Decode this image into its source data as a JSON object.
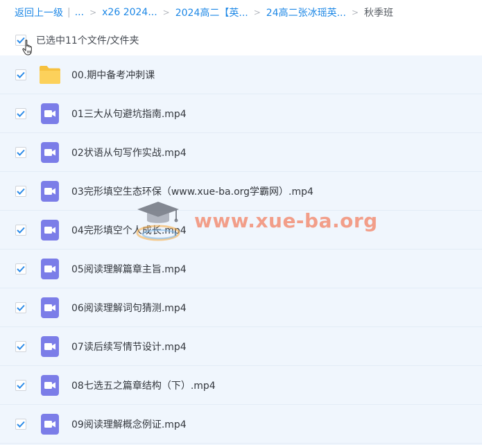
{
  "breadcrumb": {
    "back_label": "返回上一级",
    "pipe": "|",
    "ellipsis": "...",
    "items": [
      "x26 2024...",
      "2024高二【英...",
      "24高二张冰瑶英..."
    ],
    "current": "秋季班"
  },
  "selection": {
    "checked": true,
    "label": "已选中11个文件/文件夹"
  },
  "files": [
    {
      "name": "00.期中备考冲刺课",
      "type": "folder",
      "checked": true
    },
    {
      "name": "01三大从句避坑指南.mp4",
      "type": "video",
      "checked": true
    },
    {
      "name": "02状语从句写作实战.mp4",
      "type": "video",
      "checked": true
    },
    {
      "name": "03完形填空生态环保（www.xue-ba.org学霸网）.mp4",
      "type": "video",
      "checked": true
    },
    {
      "name": "04完形填空个人成长.mp4",
      "type": "video",
      "checked": true
    },
    {
      "name": "05阅读理解篇章主旨.mp4",
      "type": "video",
      "checked": true
    },
    {
      "name": "06阅读理解词句猜测.mp4",
      "type": "video",
      "checked": true
    },
    {
      "name": "07读后续写情节设计.mp4",
      "type": "video",
      "checked": true
    },
    {
      "name": "08七选五之篇章结构（下）.mp4",
      "type": "video",
      "checked": true
    },
    {
      "name": "09阅读理解概念例证.mp4",
      "type": "video",
      "checked": true
    }
  ],
  "icons": {
    "checkbox": "checkbox-checked-icon",
    "folder": "folder-icon",
    "video": "video-file-icon",
    "cursor": "hand-pointer-icon",
    "breadcrumb_separator": "chevron-right-icon"
  },
  "watermark": {
    "text": "www.xue-ba.org",
    "logo": "graduation-cap-logo"
  },
  "colors": {
    "link": "#1c87e6",
    "checkbox_check": "#2b8be8",
    "list_background": "#f0f6fd",
    "folder": "#fcd15b",
    "video_icon": "#7b7de8",
    "watermark": "#f27c5c"
  }
}
